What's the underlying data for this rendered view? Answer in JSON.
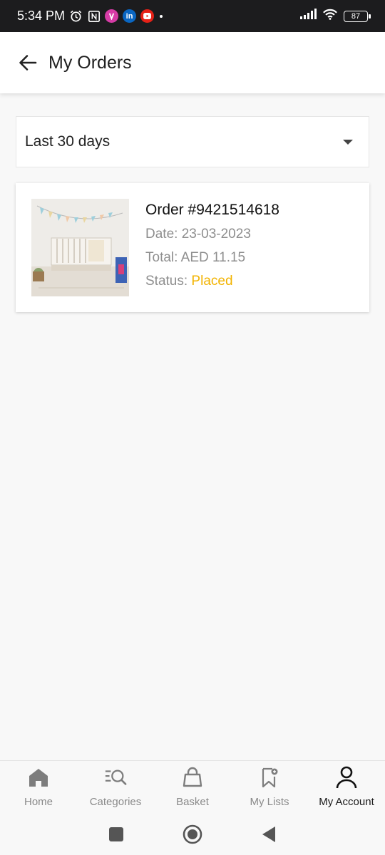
{
  "status_bar": {
    "time": "5:34 PM",
    "battery": "87",
    "icons": [
      "alarm-icon",
      "nfc-icon",
      "app-notification-icon",
      "linkedin-icon",
      "youtube-icon",
      "dot-icon",
      "signal-icon",
      "wifi-icon",
      "battery-icon"
    ]
  },
  "header": {
    "title": "My Orders",
    "back_icon": "arrow-left-icon"
  },
  "filter": {
    "selected": "Last 30 days",
    "icon": "caret-down-icon"
  },
  "orders": [
    {
      "number_label": "Order  #9421514618",
      "date_label": "Date: 23-03-2023",
      "total_label": "Total: AED 11.15",
      "status_prefix": "Status: ",
      "status": "Placed",
      "status_color": "#f2b300"
    }
  ],
  "bottom_nav": {
    "items": [
      {
        "label": "Home",
        "icon": "home-icon",
        "active": false
      },
      {
        "label": "Categories",
        "icon": "categories-search-icon",
        "active": false
      },
      {
        "label": "Basket",
        "icon": "basket-icon",
        "active": false
      },
      {
        "label": "My Lists",
        "icon": "bookmark-icon",
        "active": false
      },
      {
        "label": "My Account",
        "icon": "user-icon",
        "active": true
      }
    ]
  },
  "system_nav": [
    "recents-icon",
    "home-circle-icon",
    "back-triangle-icon"
  ]
}
